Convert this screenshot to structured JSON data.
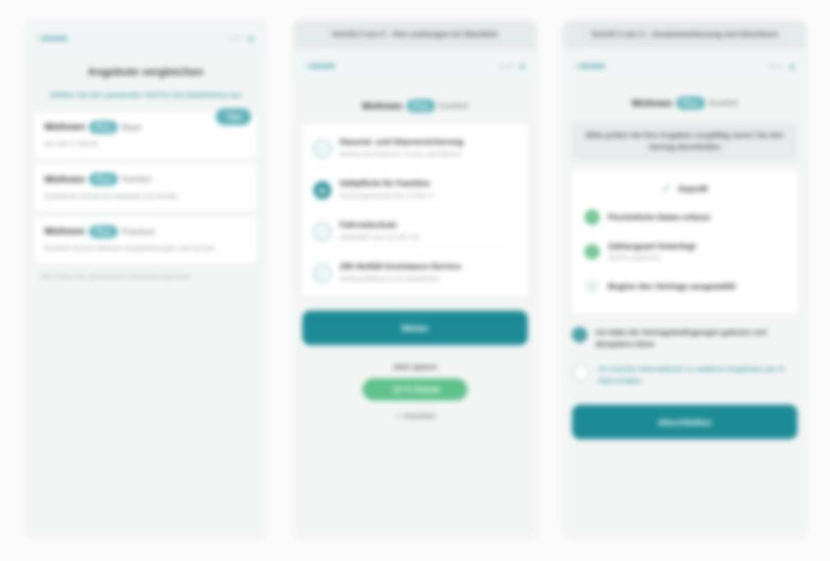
{
  "screen1": {
    "topbar": {
      "back": "‹ Zurück",
      "meta": "1 / 3",
      "menu": "≡"
    },
    "title": "Angebote vergleichen",
    "subtitle": "Wählen Sie den passenden Tarif für Ihre Bedürfnisse aus",
    "cards": [
      {
        "brand": "Wohnen",
        "pill": "Plus",
        "suffix": "Basic",
        "desc": "ab 4,90 € / Monat",
        "badge": "Tipp"
      },
      {
        "brand": "Wohnen",
        "pill": "Plus",
        "suffix": "Komfort",
        "desc": "Erweiterter Schutz für Haushalt und Familie"
      },
      {
        "brand": "Wohnen",
        "pill": "Plus",
        "suffix": "Premium",
        "desc": "Rundum-Schutz inklusive Zusatzleistungen und Service"
      }
    ],
    "footnote": "Alle Preise inkl. gesetzlicher Versicherungssteuer"
  },
  "screen2": {
    "banner": "Schritt 2 von 3 – Ihre Leistungen im Überblick",
    "topbar": {
      "back": "‹ Zurück",
      "meta": "2 / 3",
      "menu": "≡"
    },
    "brand": "Wohnen",
    "pill": "Plus",
    "suffix": "Komfort",
    "items": [
      {
        "title": "Hausrat- und Glasversicherung",
        "sub": "Schutz bei Einbruch, Feuer und Wasser",
        "icon": "check-icon",
        "filled": false
      },
      {
        "title": "Haftpflicht für Familien",
        "sub": "Deckungssumme bis 10 Mio. €",
        "icon": "shield-icon",
        "filled": true
      },
      {
        "title": "Fahrradschutz",
        "sub": "Diebstahl rund um die Uhr",
        "icon": "check-icon",
        "filled": false
      },
      {
        "title": "24h Notfall-Assistance-Service",
        "sub": "Schlüsseldienst und Handwerker",
        "icon": "check-icon",
        "filled": false
      }
    ],
    "cta": "Weiter",
    "green": {
      "label": "Jetzt sparen",
      "pill": "-15 % Rabatt",
      "below": "✓ Gesichert"
    }
  },
  "screen3": {
    "banner": "Schritt 3 von 3 – Zusammenfassung und Abschluss",
    "topbar": {
      "back": "‹ Zurück",
      "meta": "3 / 3",
      "menu": "≡"
    },
    "brand": "Wohnen",
    "pill": "Plus",
    "suffix": "Komfort",
    "warning": "Bitte prüfen Sie Ihre Angaben sorgfältig, bevor Sie den Vertrag abschließen",
    "check_head": "Geprüft",
    "checks": [
      {
        "title": "Persönliche Daten erfasst",
        "sub": "",
        "light": false
      },
      {
        "title": "Zahlungsart hinterlegt",
        "sub": "SEPA-Lastschrift",
        "light": false
      },
      {
        "title": "Beginn des Vertrags ausgewählt",
        "sub": "",
        "light": true
      }
    ],
    "consents": [
      {
        "text": "Ich habe die Vertragsbedingungen gelesen und akzeptiere diese",
        "checked": true
      },
      {
        "text": "Ich möchte Informationen zu weiteren Angeboten per E-Mail erhalten",
        "checked": false
      }
    ],
    "cta": "Abschließen"
  },
  "colors": {
    "accent": "#1d8b95",
    "accent_light": "#57b1b8",
    "success": "#5fc28b",
    "background": "#f3f5f5"
  }
}
